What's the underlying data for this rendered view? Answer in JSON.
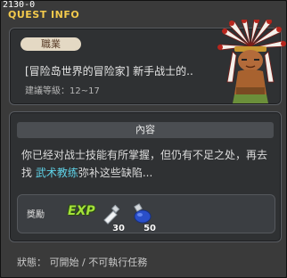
{
  "window": {
    "quest_id": "2130-0",
    "title": "QUEST INFO"
  },
  "header": {
    "job_tag": "職業",
    "quest_name": "[冒险岛世界的冒险家] 新手战士的..",
    "recommend_level": "建議等級：12~17",
    "npc_icon": "native-chief-npc-icon"
  },
  "content": {
    "heading": "內容",
    "text_before": "你已经对战士技能有所掌握，但仍有不足之处，再去找 ",
    "text_highlight": "武术教练",
    "text_after": "弥补这些缺陷..."
  },
  "reward": {
    "label": "獎勵",
    "exp_label": "EXP",
    "items": [
      {
        "icon": "white-potion-icon",
        "quantity": "30"
      },
      {
        "icon": "blue-potion-icon",
        "quantity": "50"
      }
    ]
  },
  "status": {
    "text": "狀態：  可開始  / 不可執行任務"
  },
  "colors": {
    "title": "#f2c94c",
    "highlight": "#5fd3e8",
    "exp": "#a4e13a"
  }
}
